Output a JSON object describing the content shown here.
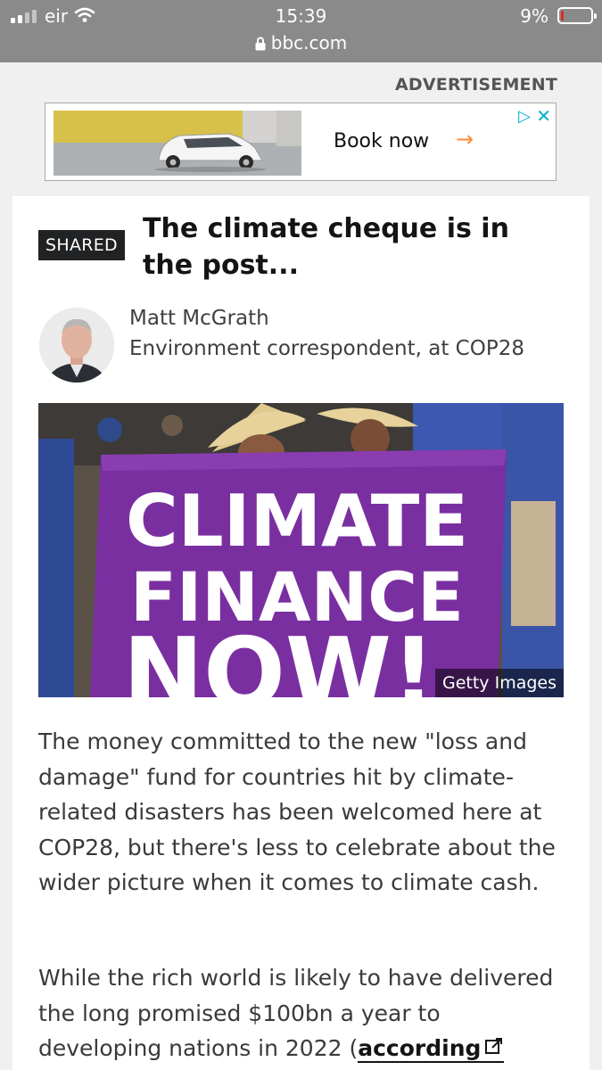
{
  "status": {
    "carrier": "eir",
    "time": "15:39",
    "url": "bbc.com",
    "battery": "9%",
    "battery_level": 0.09,
    "signal_bars": 2
  },
  "ad": {
    "label": "ADVERTISEMENT",
    "cta": "Book now",
    "icons": [
      "ad-choices-icon",
      "close-icon"
    ],
    "cta_arrow_color": "#ff8a33"
  },
  "article": {
    "badge": "SHARED",
    "headline": "The climate cheque is in the post...",
    "author": {
      "name": "Matt McGrath",
      "role": "Environment correspondent, at COP28"
    },
    "photo": {
      "banner_lines": [
        "CLIMATE",
        "FINANCE",
        "NOW!"
      ],
      "credit": "Getty Images"
    },
    "paragraphs": [
      "The money committed to the new \"loss and damage\" fund for countries hit by climate-related disasters has been welcomed here at COP28, but there's less to celebrate about the wider picture when it comes to climate cash.",
      "While the rich world is likely to have delivered the long promised $100bn a year to developing nations in 2022 ("
    ],
    "link_text": "according",
    "colors": {
      "banner": "#7a2fa0",
      "badge": "#202224"
    }
  }
}
